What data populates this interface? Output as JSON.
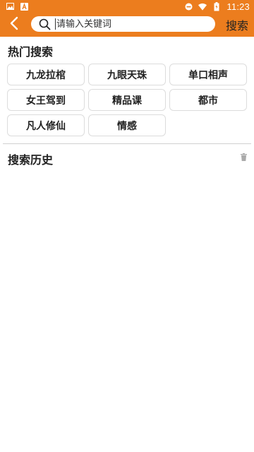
{
  "status_bar": {
    "time": "11:23",
    "left_icons": [
      "image-icon",
      "notification-a-icon"
    ],
    "right_icons": [
      "dnd-icon",
      "wifi-icon",
      "battery-icon"
    ]
  },
  "app_bar": {
    "background": "#ec7d1e",
    "search_placeholder": "请输入关键词",
    "search_button": "搜索"
  },
  "hot_search": {
    "title": "热门搜索",
    "tags": [
      "九龙拉棺",
      "九眼天珠",
      "单口相声",
      "女王驾到",
      "精品课",
      "都市",
      "凡人修仙",
      "情感"
    ]
  },
  "history": {
    "title": "搜索历史",
    "clear_icon": "trash-icon"
  }
}
